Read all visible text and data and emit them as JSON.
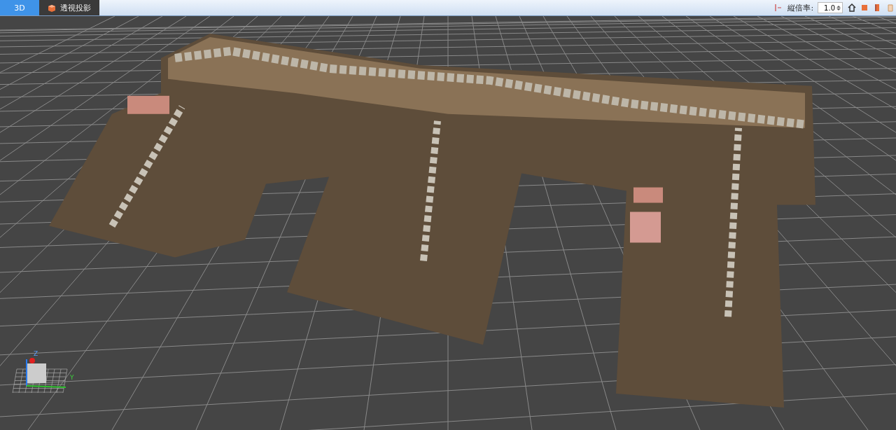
{
  "tabs": [
    {
      "label": "3D",
      "selected": true,
      "kind": "plain"
    },
    {
      "label": "透視投影",
      "selected": false,
      "kind": "cube"
    }
  ],
  "toolbar": {
    "label": "縦倍率:",
    "value": "1.0"
  },
  "gizmo": {
    "axes": [
      "Z",
      "Y"
    ]
  }
}
